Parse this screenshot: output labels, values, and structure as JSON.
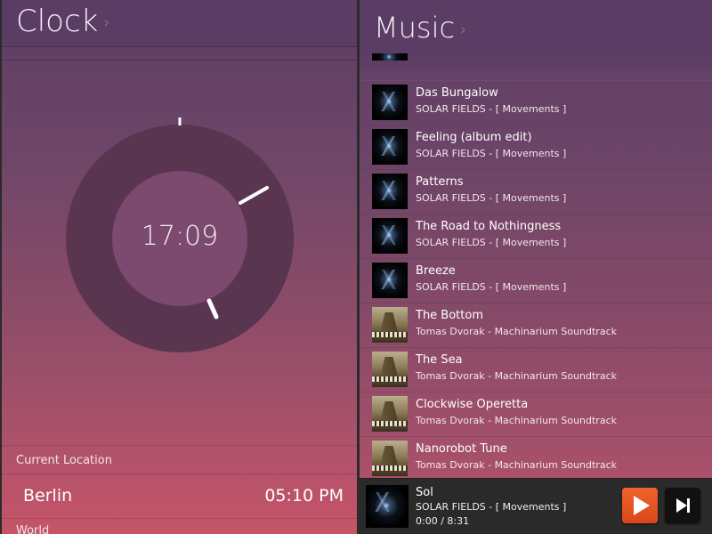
{
  "clock": {
    "title": "Clock",
    "time": "17:09",
    "current_location_label": "Current Location",
    "city": "Berlin",
    "city_time": "05:10 PM",
    "world_label": "World"
  },
  "music": {
    "title": "Music",
    "tracks": [
      {
        "title": "Das Bungalow",
        "subtitle": "SOLAR FIELDS - [ Movements ]",
        "cover": "solar"
      },
      {
        "title": "Feeling (album edit)",
        "subtitle": "SOLAR FIELDS - [ Movements ]",
        "cover": "solar"
      },
      {
        "title": "Patterns",
        "subtitle": "SOLAR FIELDS - [ Movements ]",
        "cover": "solar"
      },
      {
        "title": "The Road to Nothingness",
        "subtitle": "SOLAR FIELDS - [ Movements ]",
        "cover": "solar"
      },
      {
        "title": "Breeze",
        "subtitle": "SOLAR FIELDS - [ Movements ]",
        "cover": "solar"
      },
      {
        "title": "The Bottom",
        "subtitle": "Tomas Dvorak - Machinarium Soundtrack",
        "cover": "machinarium"
      },
      {
        "title": "The Sea",
        "subtitle": "Tomas Dvorak - Machinarium Soundtrack",
        "cover": "machinarium"
      },
      {
        "title": "Clockwise Operetta",
        "subtitle": "Tomas Dvorak - Machinarium Soundtrack",
        "cover": "machinarium"
      },
      {
        "title": "Nanorobot Tune",
        "subtitle": "Tomas Dvorak - Machinarium Soundtrack",
        "cover": "machinarium"
      }
    ],
    "now_playing": {
      "title": "Sol",
      "subtitle": "SOLAR FIELDS - [ Movements ]",
      "time": "0:00 / 8:31"
    },
    "icons": {
      "play": "play-icon",
      "next": "skip-next-icon"
    },
    "colors": {
      "play_button": "#e8552a"
    }
  }
}
